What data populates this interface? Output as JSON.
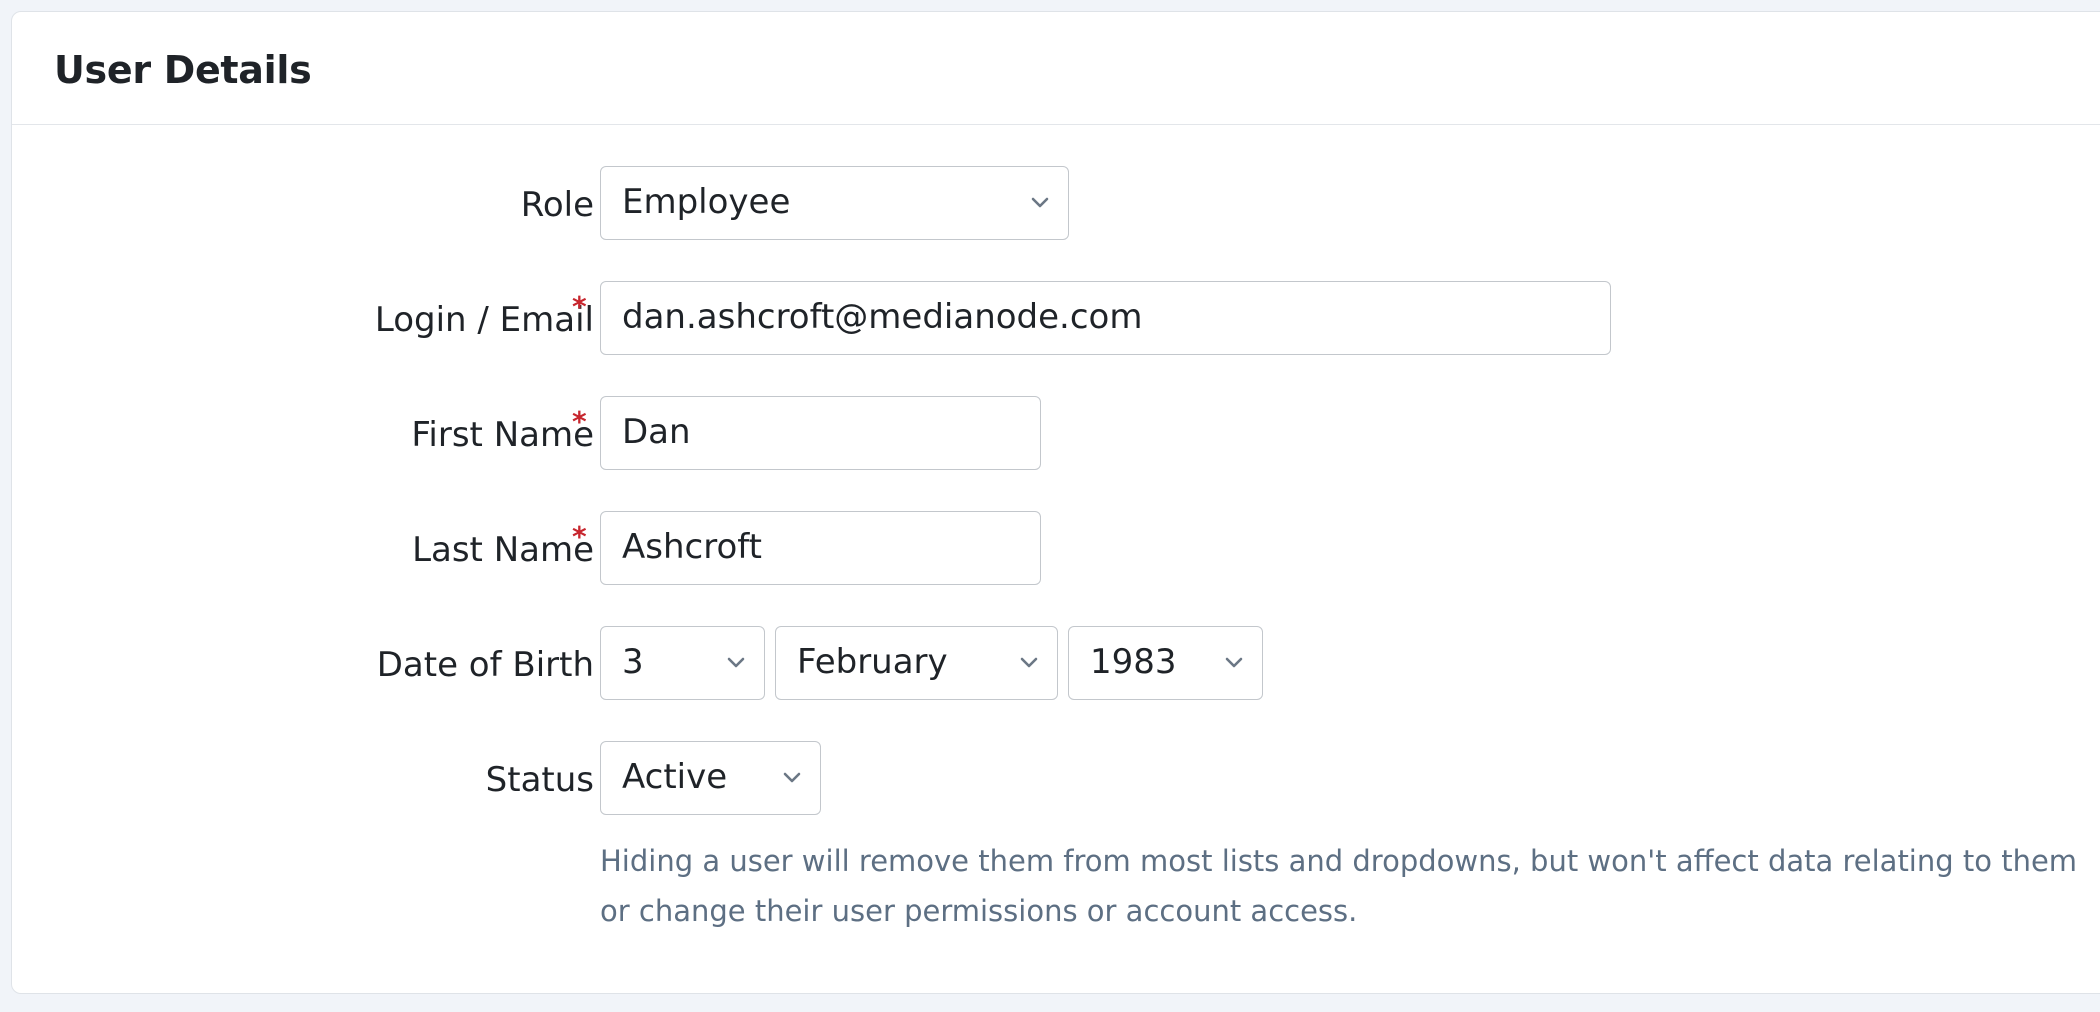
{
  "card": {
    "title": "User Details"
  },
  "form": {
    "role": {
      "label": "Role",
      "value": "Employee"
    },
    "email": {
      "label": "Login / Email",
      "required_mark": "*",
      "value": "dan.ashcroft@medianode.com"
    },
    "first_name": {
      "label": "First Name",
      "required_mark": "*",
      "value": "Dan"
    },
    "last_name": {
      "label": "Last Name",
      "required_mark": "*",
      "value": "Ashcroft"
    },
    "dob": {
      "label": "Date of Birth",
      "day": "3",
      "month": "February",
      "year": "1983"
    },
    "status": {
      "label": "Status",
      "value": "Active",
      "help": "Hiding a user will remove them from most lists and dropdowns, but won't affect data relating to them or change their user permissions or account access."
    }
  },
  "colors": {
    "required": "#c7262e",
    "help_text": "#5d6f83",
    "border": "#c3c7cc",
    "background": "#f1f4f9"
  },
  "icons": {
    "dropdown": "chevron-down-icon"
  }
}
